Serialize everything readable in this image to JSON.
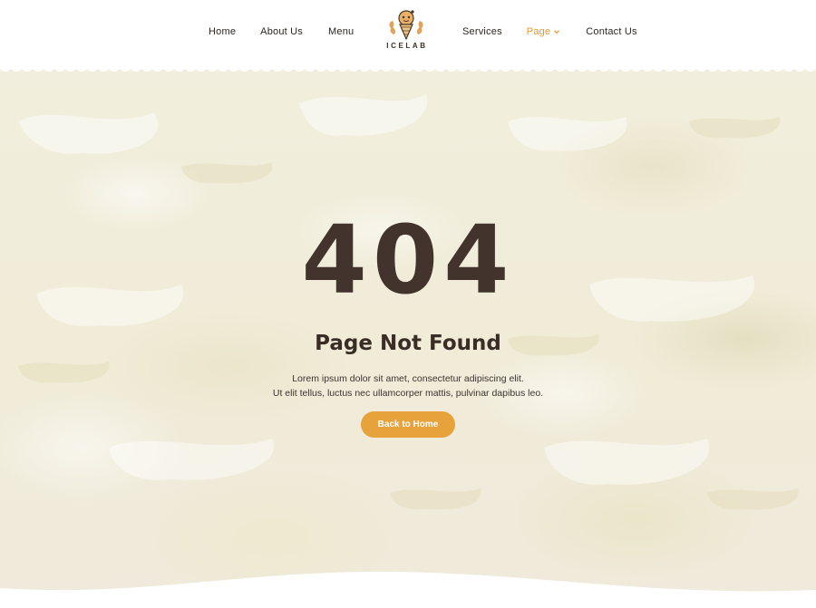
{
  "header": {
    "nav_left": [
      "Home",
      "About Us",
      "Menu"
    ],
    "logo_text": "ICELAB",
    "nav_right": [
      "Services",
      "Page",
      "Contact Us"
    ],
    "active_color": "#e39a34"
  },
  "hero": {
    "error_code": "404",
    "title": "Page Not Found",
    "desc_line1": "Lorem ipsum dolor sit amet, consectetur adipiscing elit.",
    "desc_line2": "Ut elit tellus, luctus nec ullamcorper mattis, pulvinar dapibus leo.",
    "button_label": "Back to Home",
    "button_color": "#e8a23c",
    "text_color": "#42342c"
  },
  "icons": {
    "logo": "ice-cream-cone-logo-icon",
    "page_dropdown": "chevron-down-icon"
  }
}
